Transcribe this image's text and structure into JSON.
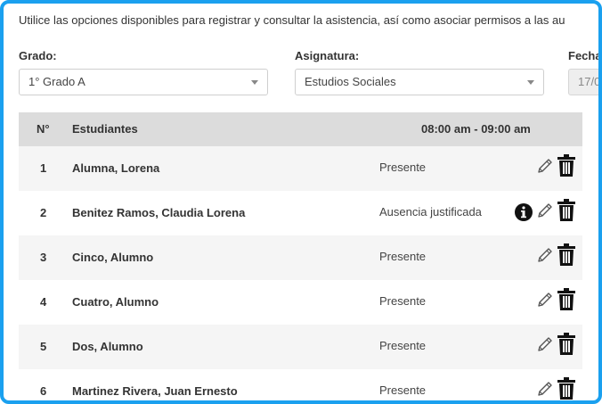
{
  "intro": "Utilice las opciones disponibles para registrar y consultar la asistencia, así como asociar permisos a las au",
  "filters": {
    "grado": {
      "label": "Grado:",
      "value": "1° Grado A"
    },
    "asignatura": {
      "label": "Asignatura:",
      "value": "Estudios Sociales"
    },
    "fecha": {
      "label": "Fecha",
      "value": "17/0"
    }
  },
  "table": {
    "headers": {
      "num": "N°",
      "students": "Estudiantes",
      "time": "08:00 am - 09:00 am"
    },
    "rows": [
      {
        "num": "1",
        "name": "Alumna, Lorena",
        "status": "Presente",
        "info": false
      },
      {
        "num": "2",
        "name": "Benitez Ramos, Claudia Lorena",
        "status": "Ausencia justificada",
        "info": true
      },
      {
        "num": "3",
        "name": "Cinco, Alumno",
        "status": "Presente",
        "info": false
      },
      {
        "num": "4",
        "name": "Cuatro, Alumno",
        "status": "Presente",
        "info": false
      },
      {
        "num": "5",
        "name": "Dos, Alumno",
        "status": "Presente",
        "info": false
      },
      {
        "num": "6",
        "name": "Martinez Rivera, Juan Ernesto",
        "status": "Presente",
        "info": false
      }
    ]
  },
  "icons": {
    "info": "info-icon",
    "edit": "pencil-icon",
    "delete": "trash-icon"
  },
  "colors": {
    "frame": "#1aa0ef",
    "header_bg": "#dcdcdc",
    "row_alt": "#f5f5f5"
  }
}
